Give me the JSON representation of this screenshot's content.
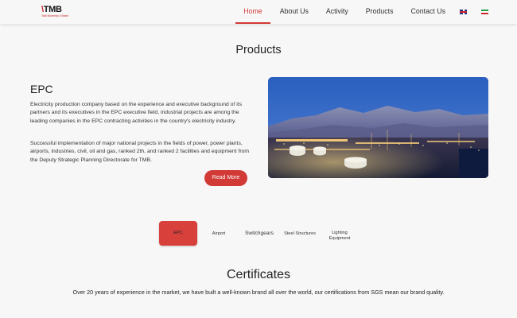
{
  "header": {
    "logo_text": "TMB",
    "logo_tagline": "Total Modernity & Brand",
    "nav": [
      {
        "label": "Home",
        "active": true
      },
      {
        "label": "About Us",
        "active": false
      },
      {
        "label": "Activity",
        "active": false
      },
      {
        "label": "Products",
        "active": false
      },
      {
        "label": "Contact Us",
        "active": false
      }
    ],
    "languages": [
      {
        "name": "uk-flag-icon"
      },
      {
        "name": "iran-flag-icon"
      }
    ]
  },
  "products": {
    "title": "Products",
    "epc": {
      "heading": "EPC",
      "paragraph1": "Electricity production company based on the experience and executive background of its partners and its executives in the EPC executive field, industrial projects are among the leading companies in the EPC contracting activities in the country's electricity industry.",
      "paragraph2": "Successful implementation of major national projects in the fields of power, power plants, airports, industries, civil, oil and gas, ranked 2th, and ranked 2 facilities and equipment from the Deputy Strategic Planning Directorate for TMB.",
      "read_more": "Read More"
    },
    "tabs": [
      "EPC",
      "Airport",
      "Switchgears",
      "Steel Structures",
      "Lighting Equipment"
    ]
  },
  "certificates": {
    "title": "Certificates",
    "text": "Over 20 years of experience in the market, we have built a well-known brand all over the world, our certifications from SGS mean our brand quality."
  },
  "colors": {
    "accent": "#d23a36",
    "background": "#f7f7f7"
  }
}
